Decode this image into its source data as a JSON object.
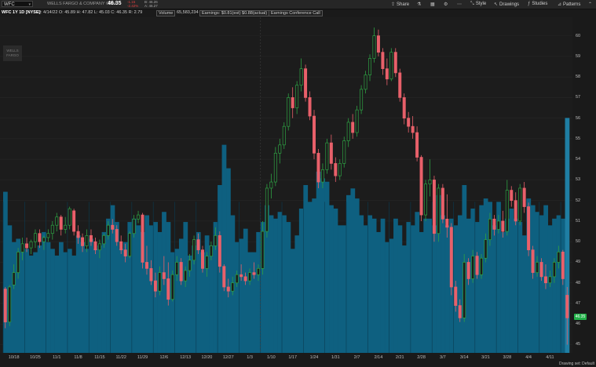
{
  "header": {
    "symbol": "WFC",
    "company": "WELLS FARGO & COMPANY COM",
    "last": "46.35",
    "change_1": "-1.15",
    "change_2": "-2.42%",
    "bid": "B: 46.26",
    "ask": "A: 46.27",
    "tools": {
      "share": "Share",
      "style": "Style",
      "drawings": "Drawings",
      "studies": "Studies",
      "patterns": "Patterns"
    }
  },
  "info": {
    "study_label": "WFC 1Y 1D [NYSE]",
    "ohlc": "D: 4/14/22  O: 45.89  H: 47.82  L: 45.03  C: 46.35  R: 2.79",
    "volume_label": "Volume",
    "volume_value": "65,583,234",
    "earnings": "Earnings: $0.81(est) $0.88(actual)",
    "conference": "Earnings Conference Call"
  },
  "logo_text": "WELLS FARGO",
  "status_text": "Drawing set: Default",
  "last_price_label": "46.35",
  "colors": {
    "up": "#2ea043",
    "down": "#e8606a",
    "volume": "#0e6080",
    "last_volume": "#1f7ea3",
    "last_price_bg": "#23b24a",
    "background": "#1c1c1c"
  },
  "chart_data": {
    "type": "candlestick",
    "title": "WFC 1Y 1D [NYSE]",
    "ylim": [
      44.6,
      60.9
    ],
    "yticks": [
      "45",
      "46",
      "47",
      "48",
      "49",
      "50",
      "51",
      "52",
      "53",
      "54",
      "55",
      "56",
      "57",
      "58",
      "59",
      "60"
    ],
    "xticks": [
      "10/18",
      "10/25",
      "11/1",
      "11/8",
      "11/15",
      "11/22",
      "11/29",
      "12/6",
      "12/13",
      "12/20",
      "12/27",
      "1/3",
      "1/10",
      "1/17",
      "1/24",
      "1/31",
      "2/7",
      "2/14",
      "2/21",
      "2/28",
      "3/7",
      "3/14",
      "3/21",
      "3/28",
      "4/4",
      "4/11"
    ],
    "candles": [
      {
        "o": 47.7,
        "h": 47.8,
        "l": 45.8,
        "c": 46.1
      },
      {
        "o": 46.1,
        "h": 47.9,
        "l": 45.9,
        "c": 47.8
      },
      {
        "o": 47.9,
        "h": 48.9,
        "l": 47.7,
        "c": 48.5
      },
      {
        "o": 48.5,
        "h": 49.7,
        "l": 48.2,
        "c": 49.5
      },
      {
        "o": 49.5,
        "h": 50.2,
        "l": 49.1,
        "c": 49.9
      },
      {
        "o": 49.9,
        "h": 50.2,
        "l": 49.5,
        "c": 49.7
      },
      {
        "o": 49.7,
        "h": 50.1,
        "l": 49.4,
        "c": 50.0
      },
      {
        "o": 50.0,
        "h": 50.6,
        "l": 49.7,
        "c": 50.4
      },
      {
        "o": 50.4,
        "h": 50.6,
        "l": 49.7,
        "c": 50.0
      },
      {
        "o": 50.0,
        "h": 50.3,
        "l": 49.6,
        "c": 50.2
      },
      {
        "o": 50.2,
        "h": 50.6,
        "l": 50.0,
        "c": 50.4
      },
      {
        "o": 50.4,
        "h": 51.0,
        "l": 50.1,
        "c": 50.8
      },
      {
        "o": 50.8,
        "h": 51.4,
        "l": 50.5,
        "c": 51.2
      },
      {
        "o": 51.2,
        "h": 51.3,
        "l": 50.3,
        "c": 50.6
      },
      {
        "o": 50.6,
        "h": 51.2,
        "l": 50.4,
        "c": 50.8
      },
      {
        "o": 50.8,
        "h": 51.7,
        "l": 50.6,
        "c": 51.6
      },
      {
        "o": 51.5,
        "h": 51.6,
        "l": 50.3,
        "c": 50.5
      },
      {
        "o": 50.5,
        "h": 50.8,
        "l": 49.9,
        "c": 50.2
      },
      {
        "o": 50.2,
        "h": 50.4,
        "l": 49.5,
        "c": 49.8
      },
      {
        "o": 49.8,
        "h": 50.6,
        "l": 49.5,
        "c": 50.3
      },
      {
        "o": 50.3,
        "h": 50.6,
        "l": 49.8,
        "c": 50.0
      },
      {
        "o": 50.0,
        "h": 50.2,
        "l": 49.4,
        "c": 49.6
      },
      {
        "o": 49.6,
        "h": 50.1,
        "l": 49.2,
        "c": 49.9
      },
      {
        "o": 49.9,
        "h": 50.4,
        "l": 49.7,
        "c": 50.3
      },
      {
        "o": 50.3,
        "h": 51.0,
        "l": 50.1,
        "c": 50.8
      },
      {
        "o": 50.8,
        "h": 51.1,
        "l": 50.4,
        "c": 50.6
      },
      {
        "o": 50.6,
        "h": 50.8,
        "l": 49.8,
        "c": 50.0
      },
      {
        "o": 50.0,
        "h": 50.3,
        "l": 49.4,
        "c": 49.6
      },
      {
        "o": 49.6,
        "h": 49.9,
        "l": 49.0,
        "c": 49.3
      },
      {
        "o": 49.3,
        "h": 50.5,
        "l": 49.2,
        "c": 50.4
      },
      {
        "o": 50.4,
        "h": 51.3,
        "l": 50.2,
        "c": 51.1
      },
      {
        "o": 51.1,
        "h": 51.5,
        "l": 50.9,
        "c": 51.3
      },
      {
        "o": 51.3,
        "h": 51.4,
        "l": 48.7,
        "c": 49.0
      },
      {
        "o": 49.0,
        "h": 49.8,
        "l": 48.4,
        "c": 48.7
      },
      {
        "o": 48.7,
        "h": 49.1,
        "l": 47.9,
        "c": 48.1
      },
      {
        "o": 48.1,
        "h": 48.5,
        "l": 47.3,
        "c": 47.6
      },
      {
        "o": 47.6,
        "h": 48.8,
        "l": 47.4,
        "c": 48.5
      },
      {
        "o": 48.5,
        "h": 49.3,
        "l": 47.9,
        "c": 48.2
      },
      {
        "o": 48.2,
        "h": 49.0,
        "l": 46.9,
        "c": 47.2
      },
      {
        "o": 47.2,
        "h": 48.6,
        "l": 47.1,
        "c": 48.4
      },
      {
        "o": 48.4,
        "h": 49.3,
        "l": 48.1,
        "c": 49.0
      },
      {
        "o": 49.0,
        "h": 49.2,
        "l": 47.9,
        "c": 48.1
      },
      {
        "o": 48.1,
        "h": 48.8,
        "l": 47.8,
        "c": 48.6
      },
      {
        "o": 48.6,
        "h": 49.4,
        "l": 48.3,
        "c": 49.1
      },
      {
        "o": 49.1,
        "h": 50.3,
        "l": 48.9,
        "c": 50.1
      },
      {
        "o": 50.1,
        "h": 50.4,
        "l": 49.4,
        "c": 49.6
      },
      {
        "o": 49.6,
        "h": 49.8,
        "l": 48.5,
        "c": 48.7
      },
      {
        "o": 48.7,
        "h": 49.5,
        "l": 48.3,
        "c": 49.3
      },
      {
        "o": 49.3,
        "h": 50.0,
        "l": 49.1,
        "c": 49.8
      },
      {
        "o": 49.8,
        "h": 50.7,
        "l": 49.6,
        "c": 50.3
      },
      {
        "o": 50.3,
        "h": 50.5,
        "l": 48.5,
        "c": 48.8
      },
      {
        "o": 48.8,
        "h": 48.9,
        "l": 47.6,
        "c": 47.8
      },
      {
        "o": 47.8,
        "h": 48.2,
        "l": 47.3,
        "c": 47.6
      },
      {
        "o": 47.6,
        "h": 48.3,
        "l": 47.4,
        "c": 48.0
      },
      {
        "o": 48.0,
        "h": 48.6,
        "l": 47.8,
        "c": 48.4
      },
      {
        "o": 48.4,
        "h": 48.9,
        "l": 48.1,
        "c": 48.3
      },
      {
        "o": 48.3,
        "h": 48.5,
        "l": 47.9,
        "c": 48.1
      },
      {
        "o": 48.1,
        "h": 48.7,
        "l": 47.9,
        "c": 48.5
      },
      {
        "o": 48.5,
        "h": 49.0,
        "l": 48.2,
        "c": 48.4
      },
      {
        "o": 48.4,
        "h": 48.9,
        "l": 48.1,
        "c": 48.7
      },
      {
        "o": 48.7,
        "h": 51.0,
        "l": 48.4,
        "c": 50.5
      },
      {
        "o": 50.5,
        "h": 52.8,
        "l": 50.2,
        "c": 52.6
      },
      {
        "o": 52.6,
        "h": 53.3,
        "l": 52.1,
        "c": 52.9
      },
      {
        "o": 52.9,
        "h": 54.6,
        "l": 52.7,
        "c": 54.3
      },
      {
        "o": 54.3,
        "h": 55.0,
        "l": 53.8,
        "c": 54.7
      },
      {
        "o": 54.7,
        "h": 55.8,
        "l": 54.5,
        "c": 55.6
      },
      {
        "o": 55.6,
        "h": 57.2,
        "l": 55.4,
        "c": 57.0
      },
      {
        "o": 57.0,
        "h": 57.5,
        "l": 56.0,
        "c": 56.5
      },
      {
        "o": 56.5,
        "h": 57.8,
        "l": 56.2,
        "c": 57.6
      },
      {
        "o": 57.6,
        "h": 58.9,
        "l": 57.3,
        "c": 58.4
      },
      {
        "o": 58.4,
        "h": 58.6,
        "l": 56.8,
        "c": 57.0
      },
      {
        "o": 57.0,
        "h": 57.3,
        "l": 55.9,
        "c": 56.1
      },
      {
        "o": 56.1,
        "h": 56.4,
        "l": 54.0,
        "c": 54.3
      },
      {
        "o": 54.3,
        "h": 54.5,
        "l": 52.6,
        "c": 52.9
      },
      {
        "o": 52.9,
        "h": 53.8,
        "l": 52.6,
        "c": 53.5
      },
      {
        "o": 53.5,
        "h": 55.0,
        "l": 53.3,
        "c": 54.8
      },
      {
        "o": 54.8,
        "h": 55.2,
        "l": 53.5,
        "c": 53.8
      },
      {
        "o": 53.8,
        "h": 54.1,
        "l": 52.9,
        "c": 53.2
      },
      {
        "o": 53.2,
        "h": 54.0,
        "l": 53.0,
        "c": 53.8
      },
      {
        "o": 53.8,
        "h": 55.1,
        "l": 53.6,
        "c": 54.9
      },
      {
        "o": 54.9,
        "h": 56.0,
        "l": 54.6,
        "c": 55.8
      },
      {
        "o": 55.8,
        "h": 56.2,
        "l": 55.0,
        "c": 55.3
      },
      {
        "o": 55.3,
        "h": 56.6,
        "l": 55.1,
        "c": 56.4
      },
      {
        "o": 56.4,
        "h": 57.6,
        "l": 56.2,
        "c": 57.4
      },
      {
        "o": 57.4,
        "h": 58.3,
        "l": 57.2,
        "c": 58.1
      },
      {
        "o": 58.1,
        "h": 59.1,
        "l": 57.8,
        "c": 58.9
      },
      {
        "o": 58.9,
        "h": 60.4,
        "l": 58.7,
        "c": 60.0
      },
      {
        "o": 60.0,
        "h": 60.3,
        "l": 59.0,
        "c": 59.2
      },
      {
        "o": 59.2,
        "h": 59.4,
        "l": 58.1,
        "c": 58.4
      },
      {
        "o": 58.4,
        "h": 58.9,
        "l": 57.6,
        "c": 57.9
      },
      {
        "o": 57.9,
        "h": 59.4,
        "l": 57.8,
        "c": 59.2
      },
      {
        "o": 59.2,
        "h": 59.4,
        "l": 58.0,
        "c": 58.2
      },
      {
        "o": 58.2,
        "h": 58.4,
        "l": 56.8,
        "c": 57.0
      },
      {
        "o": 57.0,
        "h": 57.2,
        "l": 55.7,
        "c": 56.0
      },
      {
        "o": 56.0,
        "h": 56.3,
        "l": 55.3,
        "c": 55.6
      },
      {
        "o": 55.6,
        "h": 56.1,
        "l": 55.0,
        "c": 55.3
      },
      {
        "o": 55.3,
        "h": 55.6,
        "l": 53.9,
        "c": 54.1
      },
      {
        "o": 54.1,
        "h": 54.2,
        "l": 51.0,
        "c": 51.3
      },
      {
        "o": 51.3,
        "h": 53.0,
        "l": 51.0,
        "c": 52.8
      },
      {
        "o": 52.8,
        "h": 54.0,
        "l": 52.2,
        "c": 53.0
      },
      {
        "o": 53.0,
        "h": 53.2,
        "l": 50.0,
        "c": 50.4
      },
      {
        "o": 50.4,
        "h": 52.8,
        "l": 50.0,
        "c": 52.6
      },
      {
        "o": 52.6,
        "h": 52.8,
        "l": 50.9,
        "c": 51.1
      },
      {
        "o": 51.1,
        "h": 52.3,
        "l": 50.2,
        "c": 50.7
      },
      {
        "o": 50.7,
        "h": 50.9,
        "l": 47.4,
        "c": 47.8
      },
      {
        "o": 47.8,
        "h": 48.1,
        "l": 46.6,
        "c": 46.9
      },
      {
        "o": 46.9,
        "h": 47.2,
        "l": 46.1,
        "c": 46.3
      },
      {
        "o": 46.3,
        "h": 49.4,
        "l": 46.1,
        "c": 49.0
      },
      {
        "o": 49.0,
        "h": 49.2,
        "l": 47.9,
        "c": 48.2
      },
      {
        "o": 48.2,
        "h": 49.6,
        "l": 48.0,
        "c": 49.3
      },
      {
        "o": 49.3,
        "h": 49.5,
        "l": 48.2,
        "c": 48.4
      },
      {
        "o": 48.4,
        "h": 49.4,
        "l": 48.2,
        "c": 49.2
      },
      {
        "o": 49.2,
        "h": 50.4,
        "l": 49.0,
        "c": 50.1
      },
      {
        "o": 50.1,
        "h": 51.4,
        "l": 49.8,
        "c": 51.1
      },
      {
        "o": 51.1,
        "h": 51.3,
        "l": 50.3,
        "c": 50.6
      },
      {
        "o": 50.6,
        "h": 51.3,
        "l": 50.4,
        "c": 51.0
      },
      {
        "o": 51.0,
        "h": 51.5,
        "l": 50.2,
        "c": 50.5
      },
      {
        "o": 50.5,
        "h": 53.0,
        "l": 50.3,
        "c": 52.5
      },
      {
        "o": 52.5,
        "h": 52.7,
        "l": 51.7,
        "c": 52.0
      },
      {
        "o": 52.0,
        "h": 52.4,
        "l": 50.8,
        "c": 51.0
      },
      {
        "o": 51.0,
        "h": 52.8,
        "l": 50.8,
        "c": 52.6
      },
      {
        "o": 52.6,
        "h": 52.9,
        "l": 51.4,
        "c": 51.7
      },
      {
        "o": 51.7,
        "h": 51.9,
        "l": 49.3,
        "c": 49.6
      },
      {
        "o": 49.6,
        "h": 49.8,
        "l": 48.2,
        "c": 48.5
      },
      {
        "o": 48.5,
        "h": 49.3,
        "l": 48.3,
        "c": 49.0
      },
      {
        "o": 49.0,
        "h": 49.2,
        "l": 48.1,
        "c": 48.3
      },
      {
        "o": 48.3,
        "h": 48.9,
        "l": 47.7,
        "c": 48.0
      },
      {
        "o": 48.0,
        "h": 48.6,
        "l": 47.8,
        "c": 48.3
      },
      {
        "o": 48.3,
        "h": 49.2,
        "l": 48.0,
        "c": 49.0
      },
      {
        "o": 49.0,
        "h": 49.8,
        "l": 48.7,
        "c": 49.5
      },
      {
        "o": 49.5,
        "h": 49.6,
        "l": 47.9,
        "c": 48.2
      },
      {
        "o": 47.4,
        "h": 47.8,
        "l": 45.0,
        "c": 46.3
      }
    ],
    "volume": [
      0.48,
      0.38,
      0.33,
      0.34,
      0.3,
      0.31,
      0.29,
      0.3,
      0.32,
      0.36,
      0.33,
      0.31,
      0.29,
      0.33,
      0.3,
      0.31,
      0.29,
      0.35,
      0.33,
      0.31,
      0.34,
      0.31,
      0.32,
      0.36,
      0.4,
      0.44,
      0.39,
      0.31,
      0.33,
      0.39,
      0.4,
      0.38,
      0.36,
      0.41,
      0.38,
      0.39,
      0.36,
      0.42,
      0.39,
      0.3,
      0.31,
      0.34,
      0.39,
      0.29,
      0.32,
      0.36,
      0.3,
      0.35,
      0.32,
      0.39,
      0.5,
      0.62,
      0.55,
      0.41,
      0.33,
      0.34,
      0.37,
      0.3,
      0.3,
      0.36,
      0.39,
      0.44,
      0.41,
      0.4,
      0.42,
      0.41,
      0.39,
      0.31,
      0.35,
      0.43,
      0.5,
      0.45,
      0.46,
      0.54,
      0.52,
      0.51,
      0.44,
      0.43,
      0.38,
      0.38,
      0.47,
      0.49,
      0.46,
      0.41,
      0.38,
      0.41,
      0.4,
      0.36,
      0.4,
      0.33,
      0.34,
      0.4,
      0.38,
      0.32,
      0.39,
      0.38,
      0.42,
      0.36,
      0.4,
      0.4,
      0.38,
      0.47,
      0.41,
      0.38,
      0.4,
      0.38,
      0.41,
      0.5,
      0.4,
      0.43,
      0.39,
      0.44,
      0.46,
      0.45,
      0.38,
      0.45,
      0.36,
      0.4,
      0.43,
      0.4,
      0.39,
      0.35,
      0.46,
      0.44,
      0.42,
      0.41,
      0.44,
      0.38,
      0.4,
      0.41,
      0.4,
      0.7
    ],
    "last_price": 46.35
  }
}
